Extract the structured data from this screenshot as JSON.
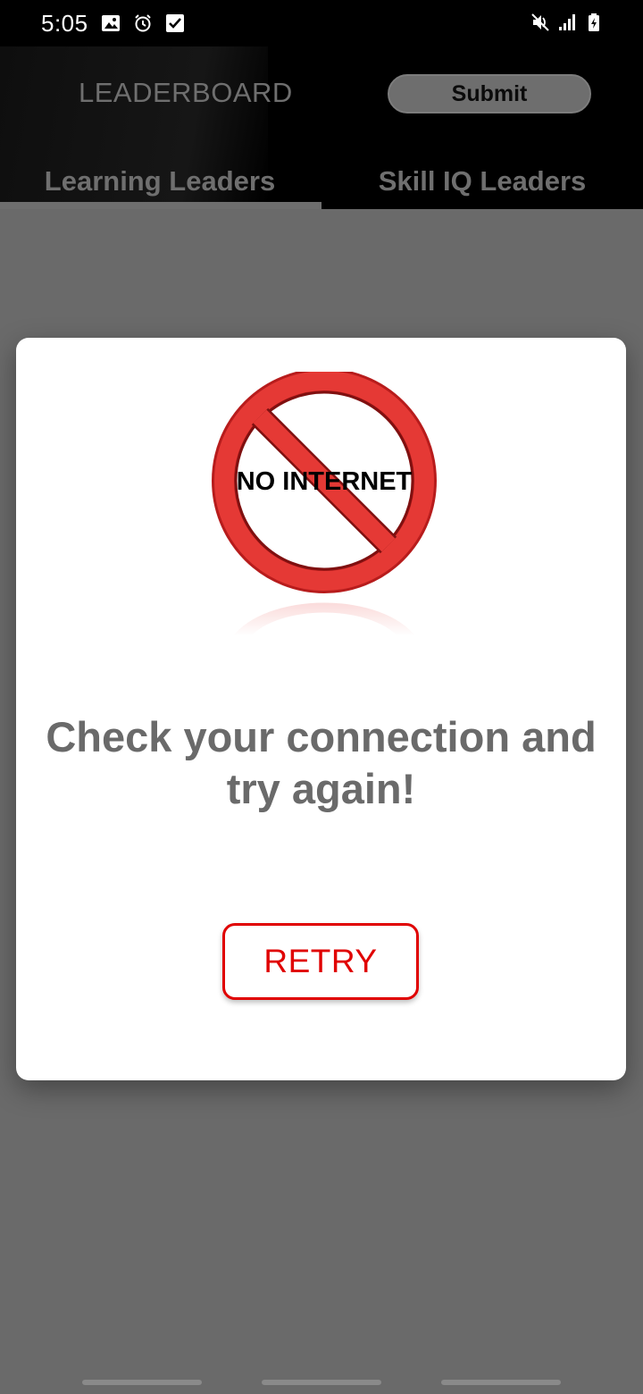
{
  "status_bar": {
    "time": "5:05",
    "left_icons": [
      "image-icon",
      "alarm-icon",
      "checkbox-icon"
    ],
    "right_icons": [
      "mute-icon",
      "signal-icon",
      "battery-charging-icon"
    ]
  },
  "header": {
    "title": "LEADERBOARD",
    "submit_label": "Submit",
    "tabs": [
      {
        "label": "Learning Leaders",
        "selected": true
      },
      {
        "label": "Skill IQ Leaders",
        "selected": false
      }
    ]
  },
  "dialog": {
    "graphic_text": "NO INTERNET",
    "graphic_icon": "no-internet-icon",
    "message": "Check your connection and try again!",
    "retry_label": "RETRY"
  },
  "colors": {
    "accent": "#e00000",
    "prohibit_red": "#e53935",
    "scrim": "#6a6a6a",
    "header_bg": "#000000"
  }
}
